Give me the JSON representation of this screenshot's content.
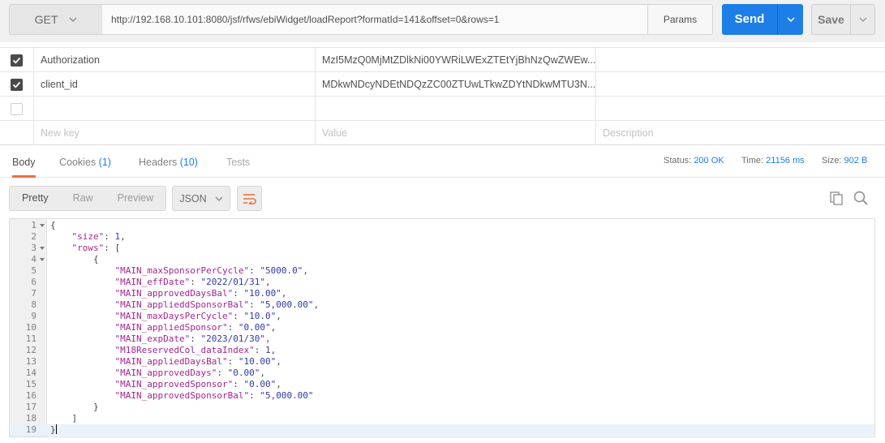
{
  "request": {
    "method": "GET",
    "url": "http://192.168.10.101:8080/jsf/rfws/ebiWidget/loadReport?formatId=141&offset=0&rows=1",
    "params_label": "Params",
    "send_label": "Send",
    "save_label": "Save"
  },
  "headers": {
    "rows": [
      {
        "checked": true,
        "key": "Authorization",
        "value": "MzI5MzQ0MjMtZDlkNi00YWRiLWExZTEtYjBhNzQwZWEw..."
      },
      {
        "checked": true,
        "key": "client_id",
        "value": "MDkwNDcyNDEtNDQzZC00ZTUwLTkwZDYtNDkwMTU3N..."
      },
      {
        "checked": false,
        "key": "",
        "value": ""
      }
    ],
    "placeholders": {
      "key": "New key",
      "value": "Value",
      "description": "Description"
    }
  },
  "response_tabs": [
    {
      "label": "Body",
      "count": "",
      "state": "active"
    },
    {
      "label": "Cookies",
      "count": "(1)",
      "state": "normal"
    },
    {
      "label": "Headers",
      "count": "(10)",
      "state": "normal"
    },
    {
      "label": "Tests",
      "count": "",
      "state": "disabled"
    }
  ],
  "status": {
    "status_label": "Status:",
    "status_value": "200 OK",
    "time_label": "Time:",
    "time_value": "21156 ms",
    "size_label": "Size:",
    "size_value": "902 B"
  },
  "view_modes": {
    "pretty": "Pretty",
    "raw": "Raw",
    "preview": "Preview",
    "active": "Pretty"
  },
  "format": "JSON",
  "icons": {
    "method_dropdown": "chevron-down-icon",
    "send_dropdown": "chevron-down-icon",
    "save_dropdown": "chevron-down-icon",
    "wrap": "wrap-lines-icon",
    "copy": "copy-icon",
    "search": "search-icon"
  },
  "colors": {
    "accent": "#1d7ee8",
    "tab_indicator": "#f06e40",
    "wrap_icon": "#f06e40"
  },
  "code": {
    "current_line": 19,
    "lines": [
      {
        "n": "1",
        "fold": true,
        "indent": 0,
        "parts": [
          {
            "t": "{",
            "c": "p"
          }
        ]
      },
      {
        "n": "2",
        "fold": false,
        "indent": 1,
        "parts": [
          {
            "t": "\"size\"",
            "c": "k"
          },
          {
            "t": ": ",
            "c": "p"
          },
          {
            "t": "1",
            "c": "n"
          },
          {
            "t": ",",
            "c": "p"
          }
        ]
      },
      {
        "n": "3",
        "fold": true,
        "indent": 1,
        "parts": [
          {
            "t": "\"rows\"",
            "c": "k"
          },
          {
            "t": ": [",
            "c": "p"
          }
        ]
      },
      {
        "n": "4",
        "fold": true,
        "indent": 2,
        "parts": [
          {
            "t": "{",
            "c": "p"
          }
        ]
      },
      {
        "n": "5",
        "fold": false,
        "indent": 3,
        "parts": [
          {
            "t": "\"MAIN_maxSponsorPerCycle\"",
            "c": "k"
          },
          {
            "t": ": ",
            "c": "p"
          },
          {
            "t": "\"5000.0\"",
            "c": "s"
          },
          {
            "t": ",",
            "c": "p"
          }
        ]
      },
      {
        "n": "6",
        "fold": false,
        "indent": 3,
        "parts": [
          {
            "t": "\"MAIN_effDate\"",
            "c": "k"
          },
          {
            "t": ": ",
            "c": "p"
          },
          {
            "t": "\"2022/01/31\"",
            "c": "s"
          },
          {
            "t": ",",
            "c": "p"
          }
        ]
      },
      {
        "n": "7",
        "fold": false,
        "indent": 3,
        "parts": [
          {
            "t": "\"MAIN_approvedDaysBal\"",
            "c": "k"
          },
          {
            "t": ": ",
            "c": "p"
          },
          {
            "t": "\"10.00\"",
            "c": "s"
          },
          {
            "t": ",",
            "c": "p"
          }
        ]
      },
      {
        "n": "8",
        "fold": false,
        "indent": 3,
        "parts": [
          {
            "t": "\"MAIN_applieddSponsorBal\"",
            "c": "k"
          },
          {
            "t": ": ",
            "c": "p"
          },
          {
            "t": "\"5,000.00\"",
            "c": "s"
          },
          {
            "t": ",",
            "c": "p"
          }
        ]
      },
      {
        "n": "9",
        "fold": false,
        "indent": 3,
        "parts": [
          {
            "t": "\"MAIN_maxDaysPerCycle\"",
            "c": "k"
          },
          {
            "t": ": ",
            "c": "p"
          },
          {
            "t": "\"10.0\"",
            "c": "s"
          },
          {
            "t": ",",
            "c": "p"
          }
        ]
      },
      {
        "n": "10",
        "fold": false,
        "indent": 3,
        "parts": [
          {
            "t": "\"MAIN_appliedSponsor\"",
            "c": "k"
          },
          {
            "t": ": ",
            "c": "p"
          },
          {
            "t": "\"0.00\"",
            "c": "s"
          },
          {
            "t": ",",
            "c": "p"
          }
        ]
      },
      {
        "n": "11",
        "fold": false,
        "indent": 3,
        "parts": [
          {
            "t": "\"MAIN_expDate\"",
            "c": "k"
          },
          {
            "t": ": ",
            "c": "p"
          },
          {
            "t": "\"2023/01/30\"",
            "c": "s"
          },
          {
            "t": ",",
            "c": "p"
          }
        ]
      },
      {
        "n": "12",
        "fold": false,
        "indent": 3,
        "parts": [
          {
            "t": "\"M18ReservedCol_dataIndex\"",
            "c": "k"
          },
          {
            "t": ": ",
            "c": "p"
          },
          {
            "t": "1",
            "c": "n"
          },
          {
            "t": ",",
            "c": "p"
          }
        ]
      },
      {
        "n": "13",
        "fold": false,
        "indent": 3,
        "parts": [
          {
            "t": "\"MAIN_appliedDaysBal\"",
            "c": "k"
          },
          {
            "t": ": ",
            "c": "p"
          },
          {
            "t": "\"10.00\"",
            "c": "s"
          },
          {
            "t": ",",
            "c": "p"
          }
        ]
      },
      {
        "n": "14",
        "fold": false,
        "indent": 3,
        "parts": [
          {
            "t": "\"MAIN_approvedDays\"",
            "c": "k"
          },
          {
            "t": ": ",
            "c": "p"
          },
          {
            "t": "\"0.00\"",
            "c": "s"
          },
          {
            "t": ",",
            "c": "p"
          }
        ]
      },
      {
        "n": "15",
        "fold": false,
        "indent": 3,
        "parts": [
          {
            "t": "\"MAIN_approvedSponsor\"",
            "c": "k"
          },
          {
            "t": ": ",
            "c": "p"
          },
          {
            "t": "\"0.00\"",
            "c": "s"
          },
          {
            "t": ",",
            "c": "p"
          }
        ]
      },
      {
        "n": "16",
        "fold": false,
        "indent": 3,
        "parts": [
          {
            "t": "\"MAIN_approvedSponsorBal\"",
            "c": "k"
          },
          {
            "t": ": ",
            "c": "p"
          },
          {
            "t": "\"5,000.00\"",
            "c": "s"
          }
        ]
      },
      {
        "n": "17",
        "fold": false,
        "indent": 2,
        "parts": [
          {
            "t": "}",
            "c": "p"
          }
        ]
      },
      {
        "n": "18",
        "fold": false,
        "indent": 1,
        "parts": [
          {
            "t": "]",
            "c": "p"
          }
        ]
      },
      {
        "n": "19",
        "fold": false,
        "indent": 0,
        "parts": [
          {
            "t": "}",
            "c": "p"
          }
        ]
      }
    ]
  }
}
